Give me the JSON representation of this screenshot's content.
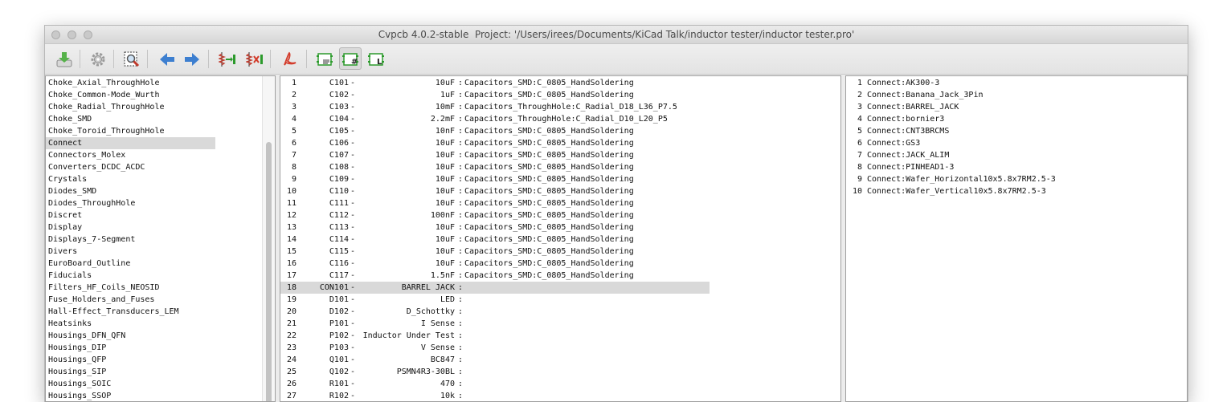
{
  "window": {
    "title": "Cvpcb 4.0.2-stable  Project: '/Users/irees/Documents/KiCad Talk/inductor tester/inductor tester.pro'"
  },
  "toolbar": {
    "buttons": [
      {
        "name": "save-netlist-button",
        "icon": "save-icon"
      },
      {
        "name": "preferences-button",
        "icon": "gear-icon"
      },
      {
        "name": "view-footprint-button",
        "icon": "view-footprint-icon"
      },
      {
        "name": "previous-button",
        "icon": "arrow-left-icon"
      },
      {
        "name": "next-button",
        "icon": "arrow-right-icon"
      },
      {
        "name": "auto-associate-button",
        "icon": "auto-associate-icon"
      },
      {
        "name": "delete-associations-button",
        "icon": "delete-association-icon"
      },
      {
        "name": "datasheet-button",
        "icon": "pdf-icon"
      },
      {
        "name": "filter-keywords-button",
        "icon": "filter-keywords-icon"
      },
      {
        "name": "filter-pin-count-button",
        "icon": "filter-pin-count-icon"
      },
      {
        "name": "filter-library-button",
        "icon": "filter-library-icon"
      }
    ],
    "colors": {
      "arrow": "#3d7fd0",
      "green": "#2c9a2c",
      "red": "#d33b2a"
    }
  },
  "libraries": {
    "selected": "Connect",
    "items": [
      "Choke_Axial_ThroughHole",
      "Choke_Common-Mode_Wurth",
      "Choke_Radial_ThroughHole",
      "Choke_SMD",
      "Choke_Toroid_ThroughHole",
      "Connect",
      "Connectors_Molex",
      "Converters_DCDC_ACDC",
      "Crystals",
      "Diodes_SMD",
      "Diodes_ThroughHole",
      "Discret",
      "Display",
      "Displays_7-Segment",
      "Divers",
      "EuroBoard_Outline",
      "Fiducials",
      "Filters_HF_Coils_NEOSID",
      "Fuse_Holders_and_Fuses",
      "Hall-Effect_Transducers_LEM",
      "Heatsinks",
      "Housings_DFN_QFN",
      "Housings_DIP",
      "Housings_QFP",
      "Housings_SIP",
      "Housings_SOIC",
      "Housings_SSOP"
    ]
  },
  "components": {
    "selected_index": 17,
    "rows": [
      {
        "num": "1",
        "ref": "C101",
        "value": "10uF",
        "footprint": "Capacitors_SMD:C_0805_HandSoldering"
      },
      {
        "num": "2",
        "ref": "C102",
        "value": "1uF",
        "footprint": "Capacitors_SMD:C_0805_HandSoldering"
      },
      {
        "num": "3",
        "ref": "C103",
        "value": "10mF",
        "footprint": "Capacitors_ThroughHole:C_Radial_D18_L36_P7.5"
      },
      {
        "num": "4",
        "ref": "C104",
        "value": "2.2mF",
        "footprint": "Capacitors_ThroughHole:C_Radial_D10_L20_P5"
      },
      {
        "num": "5",
        "ref": "C105",
        "value": "10nF",
        "footprint": "Capacitors_SMD:C_0805_HandSoldering"
      },
      {
        "num": "6",
        "ref": "C106",
        "value": "10uF",
        "footprint": "Capacitors_SMD:C_0805_HandSoldering"
      },
      {
        "num": "7",
        "ref": "C107",
        "value": "10uF",
        "footprint": "Capacitors_SMD:C_0805_HandSoldering"
      },
      {
        "num": "8",
        "ref": "C108",
        "value": "10uF",
        "footprint": "Capacitors_SMD:C_0805_HandSoldering"
      },
      {
        "num": "9",
        "ref": "C109",
        "value": "10uF",
        "footprint": "Capacitors_SMD:C_0805_HandSoldering"
      },
      {
        "num": "10",
        "ref": "C110",
        "value": "10uF",
        "footprint": "Capacitors_SMD:C_0805_HandSoldering"
      },
      {
        "num": "11",
        "ref": "C111",
        "value": "10uF",
        "footprint": "Capacitors_SMD:C_0805_HandSoldering"
      },
      {
        "num": "12",
        "ref": "C112",
        "value": "100nF",
        "footprint": "Capacitors_SMD:C_0805_HandSoldering"
      },
      {
        "num": "13",
        "ref": "C113",
        "value": "10uF",
        "footprint": "Capacitors_SMD:C_0805_HandSoldering"
      },
      {
        "num": "14",
        "ref": "C114",
        "value": "10uF",
        "footprint": "Capacitors_SMD:C_0805_HandSoldering"
      },
      {
        "num": "15",
        "ref": "C115",
        "value": "10uF",
        "footprint": "Capacitors_SMD:C_0805_HandSoldering"
      },
      {
        "num": "16",
        "ref": "C116",
        "value": "10uF",
        "footprint": "Capacitors_SMD:C_0805_HandSoldering"
      },
      {
        "num": "17",
        "ref": "C117",
        "value": "1.5nF",
        "footprint": "Capacitors_SMD:C_0805_HandSoldering"
      },
      {
        "num": "18",
        "ref": "CON101",
        "value": "BARREL JACK",
        "footprint": ""
      },
      {
        "num": "19",
        "ref": "D101",
        "value": "LED",
        "footprint": ""
      },
      {
        "num": "20",
        "ref": "D102",
        "value": "D_Schottky",
        "footprint": ""
      },
      {
        "num": "21",
        "ref": "P101",
        "value": "I Sense",
        "footprint": ""
      },
      {
        "num": "22",
        "ref": "P102",
        "value": "Inductor Under Test",
        "footprint": ""
      },
      {
        "num": "23",
        "ref": "P103",
        "value": "V Sense",
        "footprint": ""
      },
      {
        "num": "24",
        "ref": "Q101",
        "value": "BC847",
        "footprint": ""
      },
      {
        "num": "25",
        "ref": "Q102",
        "value": "PSMN4R3-30BL",
        "footprint": ""
      },
      {
        "num": "26",
        "ref": "R101",
        "value": "470",
        "footprint": ""
      },
      {
        "num": "27",
        "ref": "R102",
        "value": "10k",
        "footprint": ""
      }
    ]
  },
  "footprints": {
    "items": [
      {
        "num": "1",
        "name": "Connect:AK300-3"
      },
      {
        "num": "2",
        "name": "Connect:Banana_Jack_3Pin"
      },
      {
        "num": "3",
        "name": "Connect:BARREL_JACK"
      },
      {
        "num": "4",
        "name": "Connect:bornier3"
      },
      {
        "num": "5",
        "name": "Connect:CNT3BRCMS"
      },
      {
        "num": "6",
        "name": "Connect:GS3"
      },
      {
        "num": "7",
        "name": "Connect:JACK_ALIM"
      },
      {
        "num": "8",
        "name": "Connect:PINHEAD1-3"
      },
      {
        "num": "9",
        "name": "Connect:Wafer_Horizontal10x5.8x7RM2.5-3"
      },
      {
        "num": "10",
        "name": "Connect:Wafer_Vertical10x5.8x7RM2.5-3"
      }
    ]
  }
}
